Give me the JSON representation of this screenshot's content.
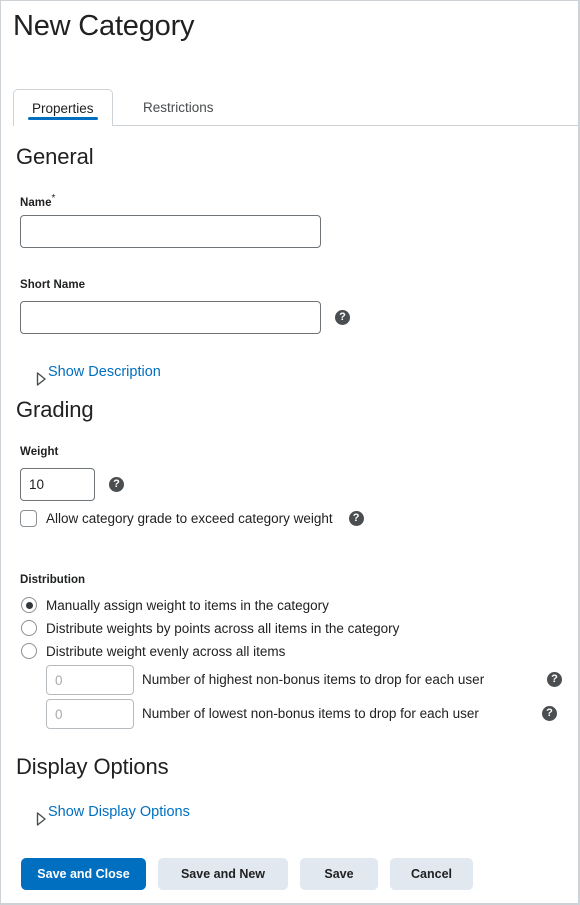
{
  "window": {
    "title": "New Category"
  },
  "tabs": [
    {
      "label": "Properties",
      "active": true
    },
    {
      "label": "Restrictions",
      "active": false
    }
  ],
  "general": {
    "heading": "General",
    "name": {
      "label": "Name",
      "required_marker": "*",
      "value": "",
      "placeholder": ""
    },
    "short_name": {
      "label": "Short Name",
      "value": "",
      "placeholder": "",
      "help_icon": "help-icon"
    },
    "show_description": {
      "label": "Show Description",
      "toggle_icon": "triangle-right-icon"
    }
  },
  "grading": {
    "heading": "Grading",
    "weight": {
      "label": "Weight",
      "value": "10",
      "help_icon": "help-icon"
    },
    "exceed_weight": {
      "label": "Allow category grade to exceed category weight",
      "checked": false,
      "help_icon": "help-icon"
    },
    "distribution": {
      "label": "Distribution",
      "options": [
        {
          "label": "Manually assign weight to items in the category",
          "selected": true
        },
        {
          "label": "Distribute weights by points across all items in the category",
          "selected": false
        },
        {
          "label": "Distribute weight evenly across all items",
          "selected": false
        }
      ],
      "drop_highest": {
        "value": "",
        "placeholder": "0",
        "label": "Number of highest non-bonus items to drop for each user",
        "help_icon": "help-icon",
        "disabled": true
      },
      "drop_lowest": {
        "value": "",
        "placeholder": "0",
        "label": "Number of lowest non-bonus items to drop for each user",
        "help_icon": "help-icon",
        "disabled": true
      }
    }
  },
  "display_options": {
    "heading": "Display Options",
    "show_display_options": {
      "label": "Show Display Options",
      "toggle_icon": "triangle-right-icon"
    }
  },
  "footer": {
    "buttons": [
      {
        "label": "Save and Close",
        "style": "primary"
      },
      {
        "label": "Save and New",
        "style": "secondary"
      },
      {
        "label": "Save",
        "style": "secondary"
      },
      {
        "label": "Cancel",
        "style": "secondary"
      }
    ]
  },
  "colors": {
    "accent": "#006fbf",
    "link": "#006fbf",
    "text": "#202122",
    "border": "#cdd2d6",
    "secondary_button": "#e2e8ef",
    "help_icon": "#4b4e50"
  }
}
